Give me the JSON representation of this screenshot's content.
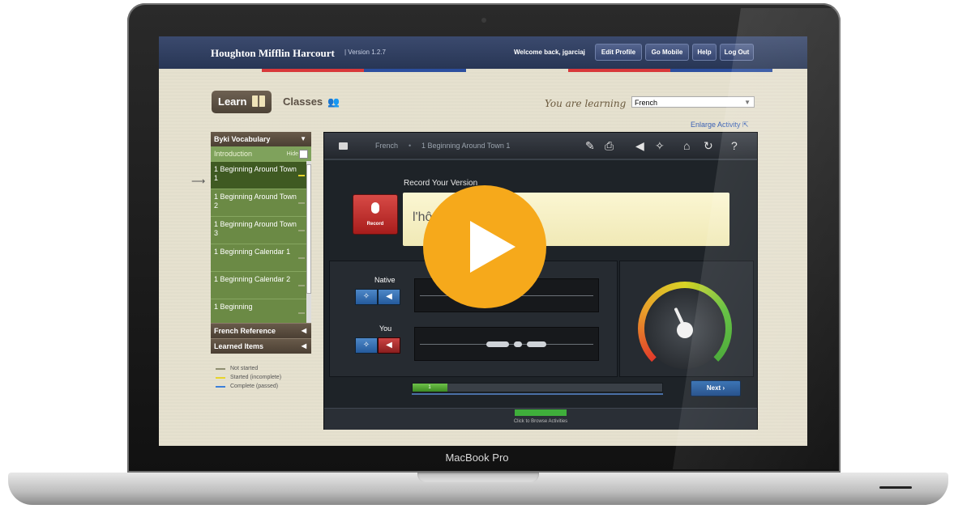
{
  "device": {
    "label": "MacBook Pro"
  },
  "header": {
    "brand": "Houghton Mifflin Harcourt",
    "version": "| Version 1.2.7",
    "welcome": "Welcome back, jgarciaj",
    "buttons": [
      "Edit Profile",
      "Go Mobile",
      "Help",
      "Log Out"
    ],
    "accent_colors": [
      "#d8383a",
      "#2b4e9e"
    ]
  },
  "nav": {
    "learn_label": "Learn",
    "classes_label": "Classes"
  },
  "language": {
    "prompt": "You are learning",
    "selected": "French"
  },
  "enlarge_label": "Enlarge Activity",
  "sidebar": {
    "title": "Byki Vocabulary",
    "intro": {
      "label": "Introduction",
      "hide_label": "Hide"
    },
    "items": [
      {
        "label": "1 Beginning Around Town 1",
        "status": "started"
      },
      {
        "label": "1 Beginning Around Town 2",
        "status": "not_started"
      },
      {
        "label": "1 Beginning Around Town 3",
        "status": "not_started"
      },
      {
        "label": "1 Beginning Calendar 1",
        "status": "not_started"
      },
      {
        "label": "1 Beginning Calendar 2",
        "status": "not_started"
      },
      {
        "label": "1 Beginning",
        "status": "not_started"
      }
    ],
    "sections": [
      "French Reference",
      "Learned Items"
    ]
  },
  "legend": [
    {
      "label": "Not started",
      "color": "#8f8f72"
    },
    {
      "label": "Started (incomplete)",
      "color": "#e6d42c"
    },
    {
      "label": "Complete (passed)",
      "color": "#3b7fd9"
    }
  ],
  "activity": {
    "breadcrumb_lang": "French",
    "breadcrumb_sep": "•",
    "breadcrumb_activity": "1 Beginning Around Town 1",
    "record_title": "Record Your Version",
    "record_button": "Record",
    "phrase": "l'hô",
    "native_label": "Native",
    "you_label": "You",
    "progress_label": "1",
    "progress_fraction": 0.14,
    "next_label": "Next",
    "browse_label": "Click to Browse Activities",
    "meter_level": 0.55
  },
  "video": {
    "play_color": "#f6a91b"
  }
}
